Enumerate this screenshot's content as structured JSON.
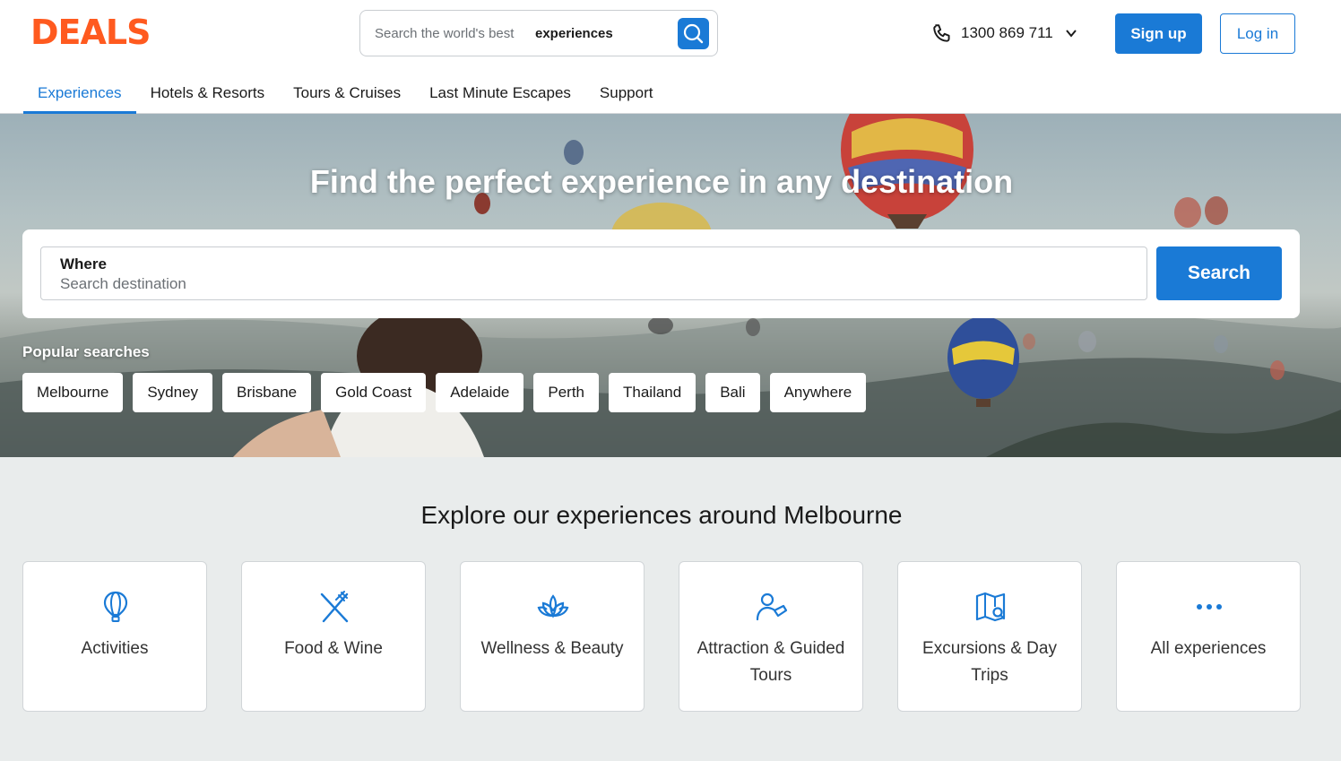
{
  "header": {
    "logo_text": "DEALS",
    "search": {
      "placeholder": "Search the world's best",
      "keyword": "experiences"
    },
    "phone": "1300 869 711",
    "signup_label": "Sign up",
    "login_label": "Log in"
  },
  "nav": {
    "items": [
      {
        "label": "Experiences",
        "active": true
      },
      {
        "label": "Hotels & Resorts"
      },
      {
        "label": "Tours & Cruises"
      },
      {
        "label": "Last Minute Escapes"
      },
      {
        "label": "Support"
      }
    ]
  },
  "hero": {
    "title": "Find the perfect experience in any destination",
    "where_label": "Where",
    "where_placeholder": "Search destination",
    "search_label": "Search",
    "popular_label": "Popular searches",
    "popular": [
      "Melbourne",
      "Sydney",
      "Brisbane",
      "Gold Coast",
      "Adelaide",
      "Perth",
      "Thailand",
      "Bali",
      "Anywhere"
    ]
  },
  "explore": {
    "title": "Explore our experiences around Melbourne",
    "categories": [
      {
        "label": "Activities",
        "icon": "hot-air-balloon-icon"
      },
      {
        "label": "Food & Wine",
        "icon": "fork-knife-icon"
      },
      {
        "label": "Wellness & Beauty",
        "icon": "lotus-icon"
      },
      {
        "label": "Attraction & Guided Tours",
        "icon": "guide-person-icon"
      },
      {
        "label": "Excursions & Day Trips",
        "icon": "map-search-icon"
      },
      {
        "label": "All experiences",
        "icon": "more-dots-icon"
      }
    ]
  },
  "colors": {
    "brand": "#ff5a1f",
    "accent": "#1a7ad6"
  }
}
